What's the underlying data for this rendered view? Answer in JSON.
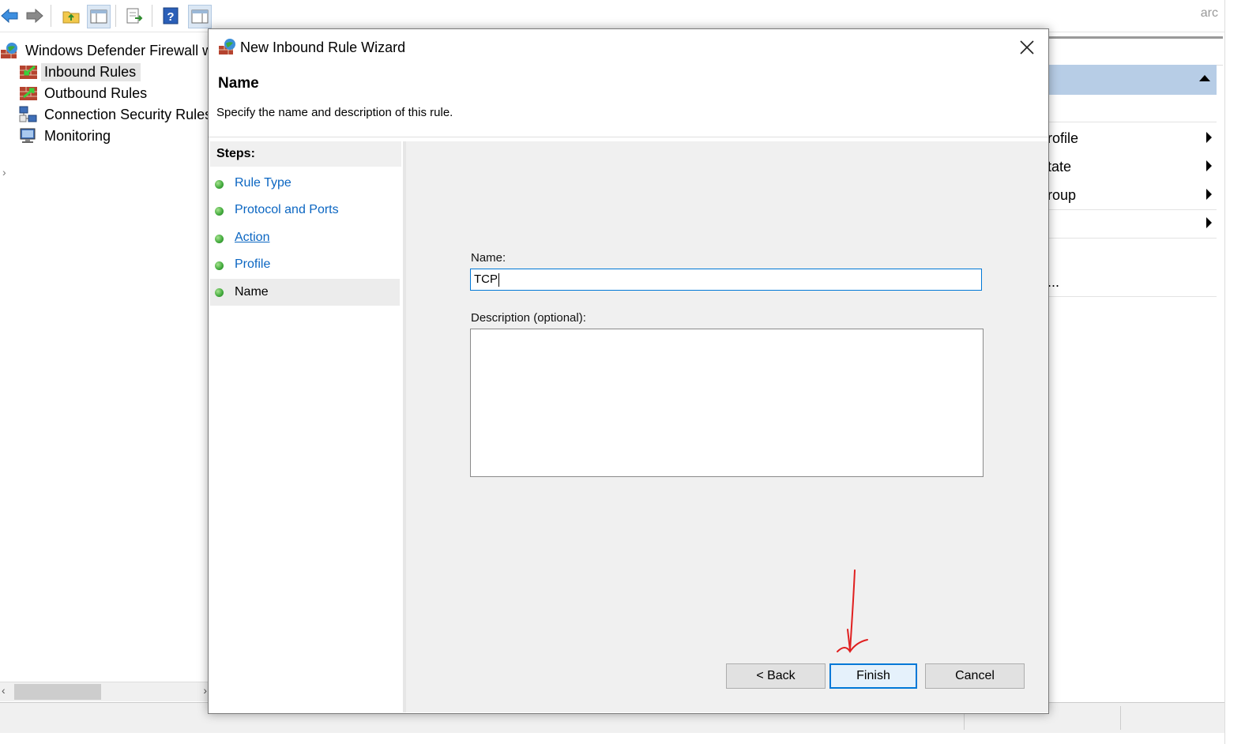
{
  "toolbar": {
    "buttons": [
      "back-arrow-icon",
      "forward-arrow-icon",
      "up-folder-icon",
      "show-hide-tree-icon",
      "export-list-icon",
      "help-icon",
      "show-hide-action-pane-icon"
    ],
    "search_fragment": "arc"
  },
  "tree": {
    "root_label": "Windows Defender Firewall wit",
    "items": [
      {
        "label": "Inbound Rules",
        "icon": "inbound-rules-icon",
        "selected": true
      },
      {
        "label": "Outbound Rules",
        "icon": "outbound-rules-icon",
        "selected": false
      },
      {
        "label": "Connection Security Rules",
        "icon": "connection-security-icon",
        "selected": false
      },
      {
        "label": "Monitoring",
        "icon": "monitoring-icon",
        "selected": false
      }
    ]
  },
  "actions_pane": {
    "items": [
      "rofile",
      "tate",
      "roup",
      "..."
    ]
  },
  "dialog": {
    "title": "New Inbound Rule Wizard",
    "heading": "Name",
    "subtitle": "Specify the name and description of this rule.",
    "steps_label": "Steps:",
    "steps": [
      {
        "label": "Rule Type",
        "underlined": false,
        "active": false
      },
      {
        "label": "Protocol and Ports",
        "underlined": false,
        "active": false
      },
      {
        "label": "Action",
        "underlined": true,
        "active": false
      },
      {
        "label": "Profile",
        "underlined": false,
        "active": false
      },
      {
        "label": "Name",
        "underlined": false,
        "active": true
      }
    ],
    "name_label": "Name:",
    "name_value": "TCP",
    "description_label": "Description (optional):",
    "description_value": "",
    "buttons": {
      "back": "< Back",
      "finish": "Finish",
      "cancel": "Cancel"
    }
  },
  "colors": {
    "link": "#0b66c2",
    "focus_border": "#0078d7",
    "annotation_arrow": "#e02020",
    "step_dot": "#3fa83a"
  }
}
